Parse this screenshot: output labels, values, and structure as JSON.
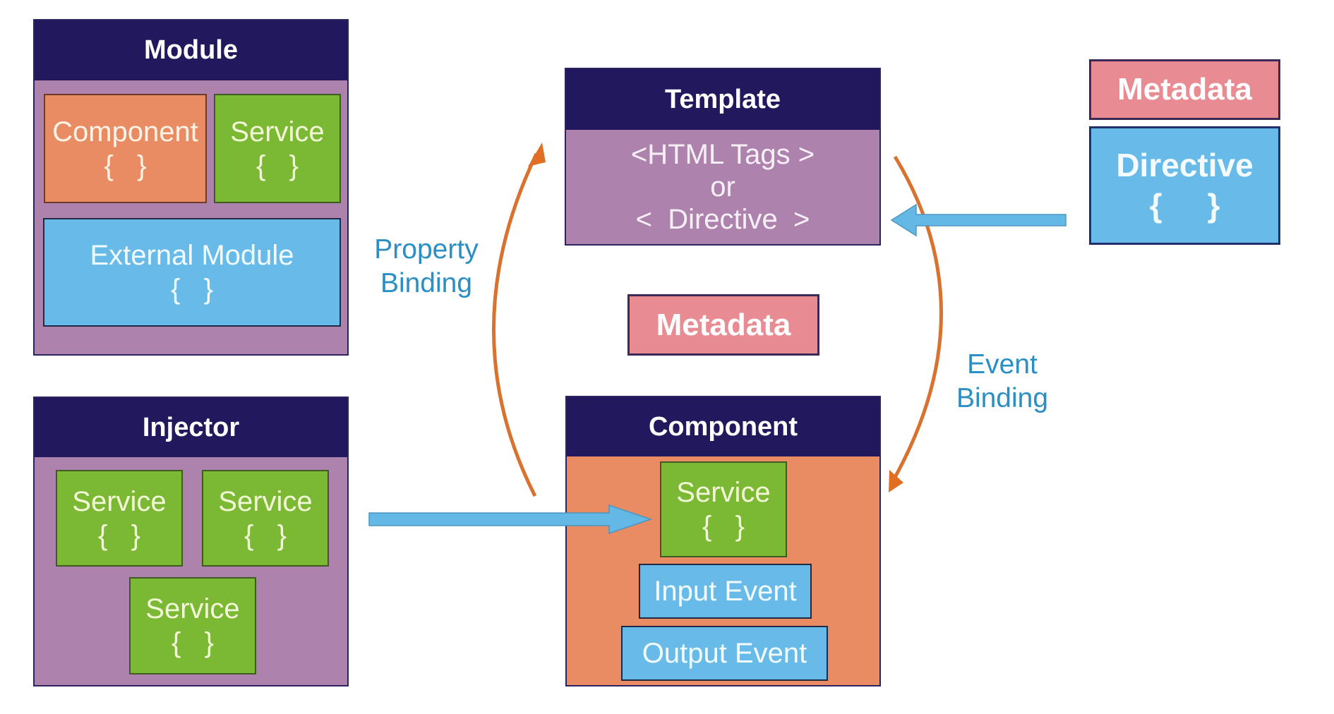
{
  "module": {
    "title": "Module",
    "component": {
      "label": "Component",
      "braces": "{   }"
    },
    "service": {
      "label": "Service",
      "braces": "{   }"
    },
    "external_module": {
      "label": "External Module",
      "braces": "{   }"
    }
  },
  "injector": {
    "title": "Injector",
    "services": [
      {
        "label": "Service",
        "braces": "{   }"
      },
      {
        "label": "Service",
        "braces": "{   }"
      },
      {
        "label": "Service",
        "braces": "{   }"
      }
    ]
  },
  "template": {
    "title": "Template",
    "lines": [
      "<HTML Tags >",
      "or",
      "<  Directive  >"
    ]
  },
  "metadata_center": {
    "label": "Metadata"
  },
  "component": {
    "title": "Component",
    "service": {
      "label": "Service",
      "braces": "{   }"
    },
    "input_event": "Input Event",
    "output_event": "Output Event"
  },
  "directive_group": {
    "metadata": "Metadata",
    "directive": {
      "label": "Directive",
      "braces": "{     }"
    }
  },
  "labels": {
    "property_binding": [
      "Property",
      "Binding"
    ],
    "event_binding": [
      "Event",
      "Binding"
    ]
  },
  "colors": {
    "header_navy": "#22185e",
    "container_purple": "#ad83ae",
    "component_orange": "#e98c63",
    "service_green": "#7bb935",
    "blue": "#68bbe8",
    "metadata_pink": "#e98b92",
    "binding_arrow_orange": "#d9722f",
    "binding_text_blue": "#2a8fc4"
  }
}
